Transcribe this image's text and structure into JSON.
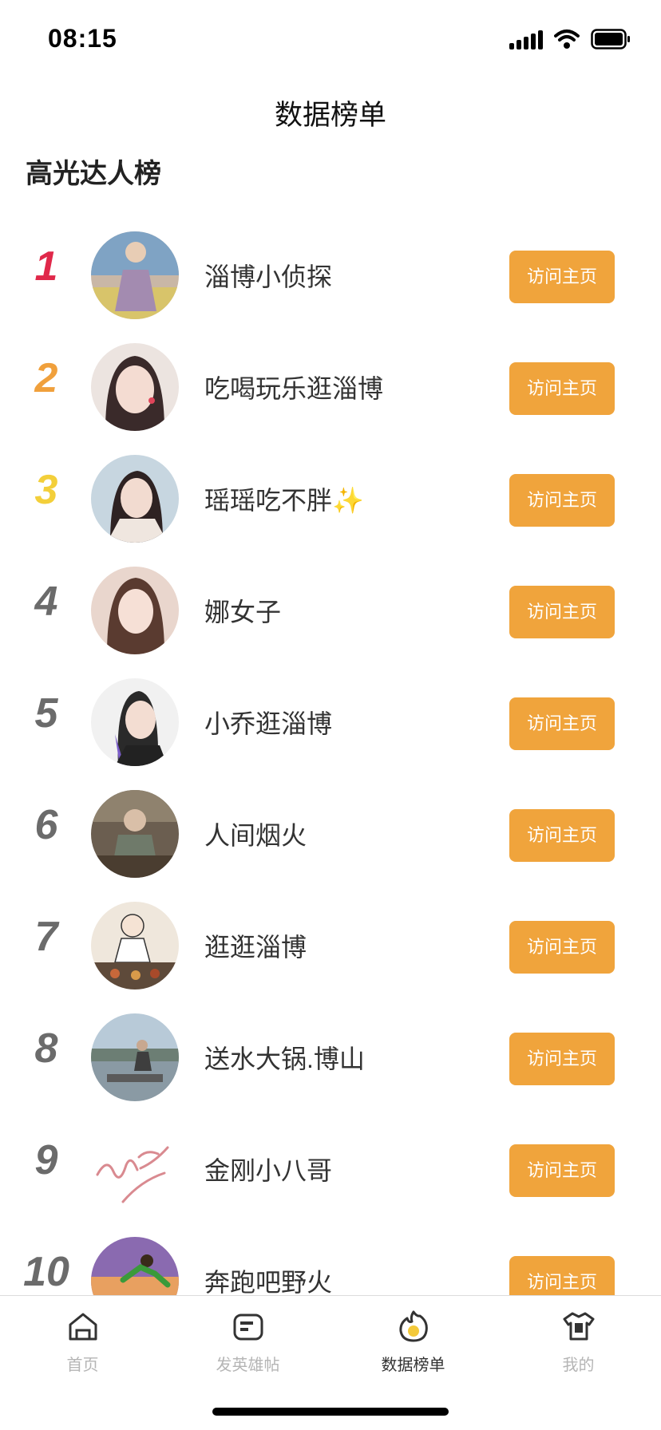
{
  "status_bar": {
    "time": "08:15"
  },
  "header": {
    "title": "数据榜单"
  },
  "section": {
    "title": "高光达人榜"
  },
  "ranking": [
    {
      "rank": "1",
      "name": "淄博小侦探",
      "action": "访问主页"
    },
    {
      "rank": "2",
      "name": "吃喝玩乐逛淄博",
      "action": "访问主页"
    },
    {
      "rank": "3",
      "name": "瑶瑶吃不胖✨",
      "action": "访问主页"
    },
    {
      "rank": "4",
      "name": "娜女子",
      "action": "访问主页"
    },
    {
      "rank": "5",
      "name": "小乔逛淄博",
      "action": "访问主页"
    },
    {
      "rank": "6",
      "name": "人间烟火",
      "action": "访问主页"
    },
    {
      "rank": "7",
      "name": "逛逛淄博",
      "action": "访问主页"
    },
    {
      "rank": "8",
      "name": "送水大锅.博山",
      "action": "访问主页"
    },
    {
      "rank": "9",
      "name": "金刚小八哥",
      "action": "访问主页"
    },
    {
      "rank": "10",
      "name": "奔跑吧野火",
      "action": "访问主页"
    }
  ],
  "tab_bar": {
    "items": [
      {
        "label": "首页",
        "icon": "home-icon"
      },
      {
        "label": "发英雄帖",
        "icon": "post-icon"
      },
      {
        "label": "数据榜单",
        "icon": "flame-icon"
      },
      {
        "label": "我的",
        "icon": "shirt-icon"
      }
    ],
    "active": "数据榜单"
  },
  "colors": {
    "accent": "#f0a43c",
    "rank_first": "#e0284a",
    "rank_second": "#f0a03c",
    "rank_third": "#f3cf3a",
    "rank_default": "#6b6b6b"
  }
}
